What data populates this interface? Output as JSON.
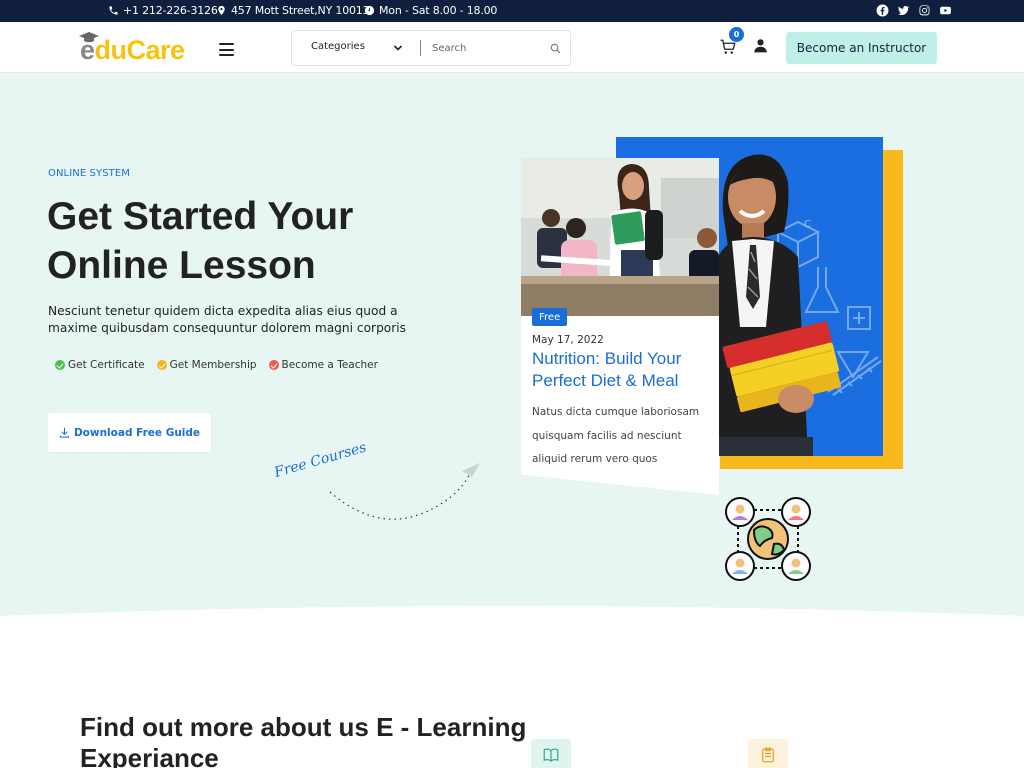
{
  "topbar": {
    "phone": "+1 212-226-3126",
    "address": "457 Mott Street,NY 10013",
    "hours": "Mon - Sat 8.00 - 18.00",
    "socials": [
      "facebook-icon",
      "twitter-icon",
      "instagram-icon",
      "youtube-icon"
    ]
  },
  "nav": {
    "logo_e": "e",
    "logo_rest": "duCare",
    "categories_label": "Categories",
    "search_placeholder": "Search",
    "cart_count": "0",
    "cta_label": "Become an Instructor"
  },
  "hero": {
    "eyebrow": "ONLINE SYSTEM",
    "title": "Get Started Your Online Lesson",
    "description": "Nesciunt tenetur quidem dicta expedita alias eius quod a maxime quibusdam consequuntur dolorem magni corporis",
    "features": [
      {
        "label": "Get Certificate",
        "color": "#4cc04c"
      },
      {
        "label": "Get Membership",
        "color": "#f3b41b"
      },
      {
        "label": "Become a Teacher",
        "color": "#ef5b4d"
      }
    ],
    "download_label": "Download Free Guide",
    "free_courses": "Free Courses"
  },
  "card": {
    "badge": "Free",
    "date": "May 17, 2022",
    "title": "Nutrition: Build Your Perfect Diet & Meal",
    "text": "Natus dicta cumque laboriosam quisquam facilis ad nesciunt aliquid rerum vero quos"
  },
  "about": {
    "title": "Find out more about us E - Learning Experiance"
  },
  "colors": {
    "primary": "#1a6dd6",
    "navy": "#0f1f3d",
    "mint": "#e8f6f3",
    "accent_yellow": "#f9b81b",
    "cta_bg": "#bff0e7"
  }
}
